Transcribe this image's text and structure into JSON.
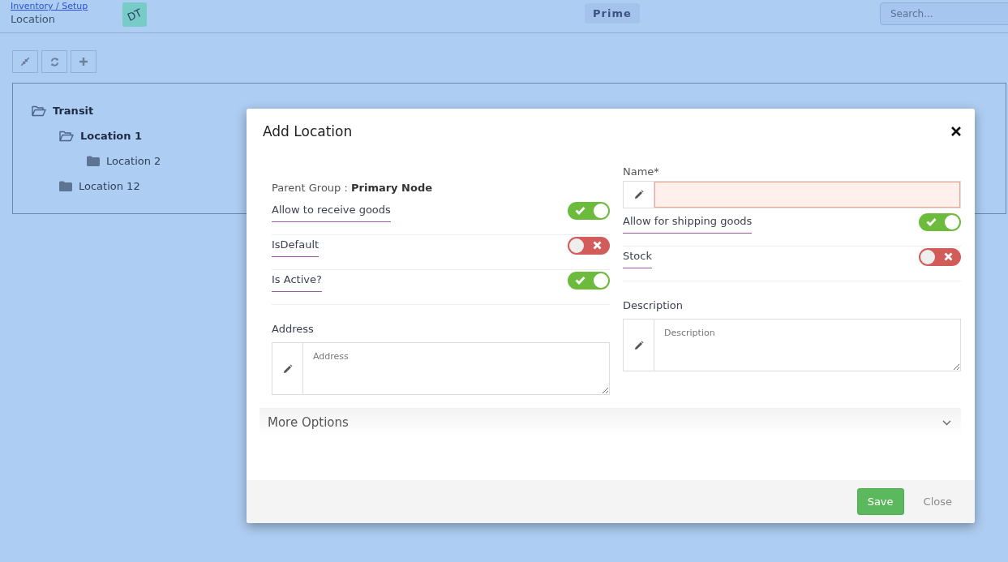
{
  "breadcrumb": {
    "link": "Inventory / Setup",
    "title": "Location"
  },
  "avatar": {
    "initials": "DT"
  },
  "company": "Prime",
  "search": {
    "placeholder": "Search..."
  },
  "toolbar": [
    {
      "kind": "collapse"
    },
    {
      "kind": "refresh"
    },
    {
      "kind": "add"
    }
  ],
  "tree": [
    {
      "label": "Transit",
      "expanded": true,
      "children": [
        {
          "label": "Location 1",
          "expanded": true,
          "children": [
            {
              "label": "Location 2",
              "expanded": false
            }
          ]
        },
        {
          "label": "Location 12",
          "expanded": false
        }
      ]
    }
  ],
  "dialog": {
    "title": "Add Location",
    "parent_group": {
      "label": "Parent Group :",
      "value": "Primary Node"
    },
    "left_toggles": [
      {
        "label": "Allow to receive goods",
        "on": true
      },
      {
        "label": "IsDefault",
        "on": false
      },
      {
        "label": "Is Active?",
        "on": true
      }
    ],
    "address": {
      "label": "Address",
      "placeholder": "Address"
    },
    "name": {
      "label": "Name*",
      "invalid": true
    },
    "right_toggles": [
      {
        "label": "Allow for shipping goods",
        "on": true
      },
      {
        "label": "Stock",
        "on": false
      }
    ],
    "description": {
      "label": "Description",
      "placeholder": "Description"
    },
    "more_options": {
      "label": "More Options",
      "expanded": false
    },
    "buttons": [
      {
        "label": "Save",
        "kind": "primary"
      },
      {
        "label": "Close",
        "kind": "link"
      }
    ]
  }
}
